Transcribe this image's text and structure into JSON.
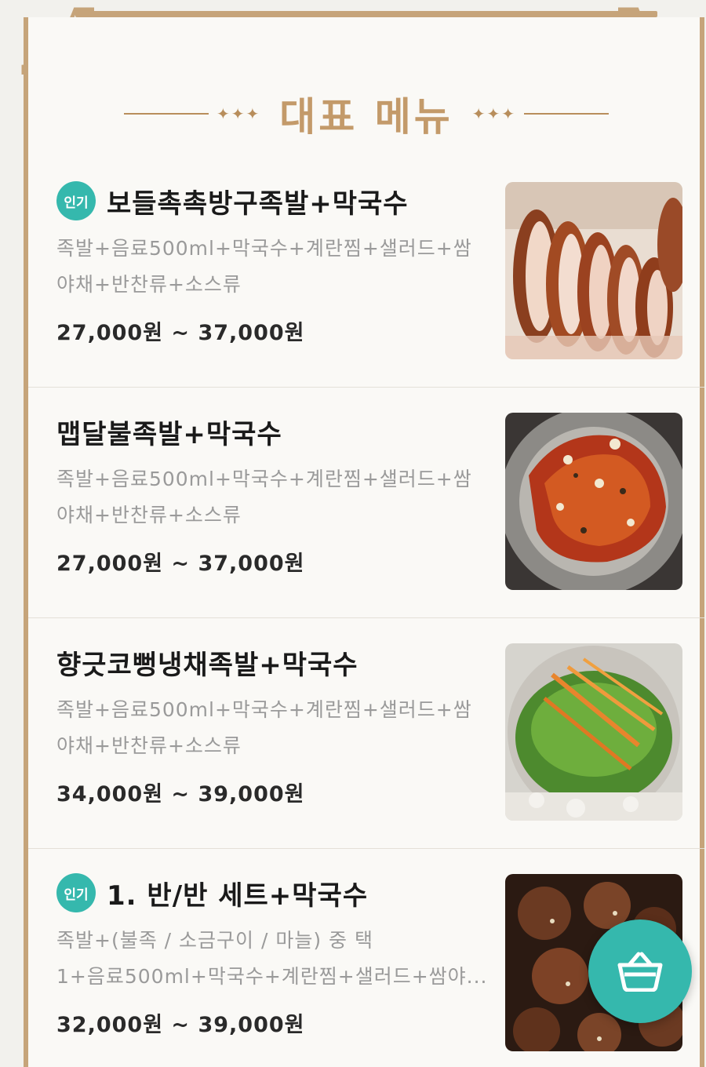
{
  "section": {
    "title": "대표 메뉴"
  },
  "colors": {
    "accent": "#c39a6a",
    "frame": "#c6a47a",
    "badge": "#35b8ad",
    "cart": "#35b8ad"
  },
  "menu": [
    {
      "badge": "인기",
      "name": "보들촉촉방구족발+막국수",
      "desc_line1": "족발+음료500ml+막국수+계란찜+샐러드+쌈",
      "desc_line2": "야채+반찬류+소스류",
      "price": "27,000원 ~ 37,000원",
      "image": "sliced-jokbal-photo"
    },
    {
      "badge": "",
      "name": "맵달불족발+막국수",
      "desc_line1": "족발+음료500ml+막국수+계란찜+샐러드+쌈",
      "desc_line2": "야채+반찬류+소스류",
      "price": "27,000원 ~ 37,000원",
      "image": "spicy-fire-jokbal-photo"
    },
    {
      "badge": "",
      "name": "향긋코뻥냉채족발+막국수",
      "desc_line1": "족발+음료500ml+막국수+계란찜+샐러드+쌈",
      "desc_line2": "야채+반찬류+소스류",
      "price": "34,000원 ~ 39,000원",
      "image": "cold-salad-jokbal-photo"
    },
    {
      "badge": "인기",
      "name": "1. 반/반 세트+막국수",
      "desc_line1": "족발+(불족 / 소금구이 / 마늘) 중 택",
      "desc_line2": "1+음료500ml+막국수+계란찜+샐러드+쌈야...",
      "price": "32,000원 ~ 39,000원",
      "image": "half-half-set-photo"
    }
  ],
  "cart": {
    "icon": "basket-icon"
  }
}
